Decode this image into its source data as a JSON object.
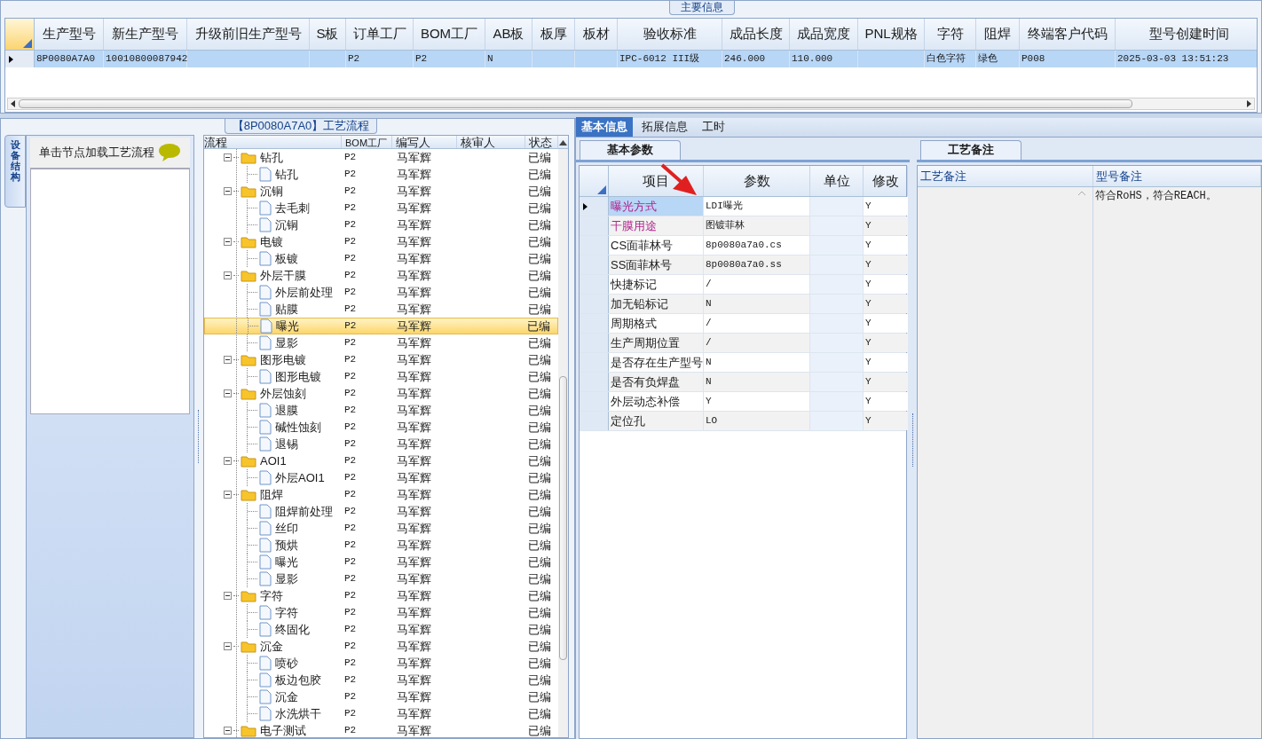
{
  "main_info": {
    "title": "主要信息",
    "columns": [
      "生产型号",
      "新生产型号",
      "升级前旧生产型号",
      "S板",
      "订单工厂",
      "BOM工厂",
      "AB板",
      "板厚",
      "板材",
      "验收标准",
      "成品长度",
      "成品宽度",
      "PNL规格",
      "字符",
      "阻焊",
      "终端客户代码",
      "型号创建时间"
    ],
    "rows": [
      {
        "selected": true,
        "cells": [
          "8P0080A7A0",
          "10010800087942",
          null,
          null,
          "P2",
          "P2",
          "N",
          null,
          null,
          "IPC-6012 III级",
          "246.000",
          "110.000",
          null,
          "白色字符",
          "绿色",
          "P008",
          "2025-03-03 13:51:23"
        ]
      }
    ]
  },
  "process_panel": {
    "title": "【8P0080A7A0】工艺流程",
    "side_tab": "设备结构",
    "hint": "单击节点加载工艺流程",
    "columns": [
      "流程",
      "BOM工厂",
      "编写人",
      "核审人",
      "状态"
    ],
    "nodes": [
      {
        "name": "钻孔",
        "bom": "P2",
        "writer": "马军辉",
        "status": "已编",
        "expanded": true,
        "selected": false,
        "children": [
          {
            "name": "钻孔",
            "bom": "P2",
            "writer": "马军辉",
            "status": "已编",
            "selected": false
          }
        ]
      },
      {
        "name": "沉铜",
        "bom": "P2",
        "writer": "马军辉",
        "status": "已编",
        "expanded": true,
        "selected": false,
        "children": [
          {
            "name": "去毛刺",
            "bom": "P2",
            "writer": "马军辉",
            "status": "已编",
            "selected": false
          },
          {
            "name": "沉铜",
            "bom": "P2",
            "writer": "马军辉",
            "status": "已编",
            "selected": false
          }
        ]
      },
      {
        "name": "电镀",
        "bom": "P2",
        "writer": "马军辉",
        "status": "已编",
        "expanded": true,
        "selected": false,
        "children": [
          {
            "name": "板镀",
            "bom": "P2",
            "writer": "马军辉",
            "status": "已编",
            "selected": false
          }
        ]
      },
      {
        "name": "外层干膜",
        "bom": "P2",
        "writer": "马军辉",
        "status": "已编",
        "expanded": true,
        "selected": false,
        "children": [
          {
            "name": "外层前处理",
            "bom": "P2",
            "writer": "马军辉",
            "status": "已编",
            "selected": false
          },
          {
            "name": "贴膜",
            "bom": "P2",
            "writer": "马军辉",
            "status": "已编",
            "selected": false
          },
          {
            "name": "曝光",
            "bom": "P2",
            "writer": "马军辉",
            "status": "已编",
            "selected": true
          },
          {
            "name": "显影",
            "bom": "P2",
            "writer": "马军辉",
            "status": "已编",
            "selected": false
          }
        ]
      },
      {
        "name": "图形电镀",
        "bom": "P2",
        "writer": "马军辉",
        "status": "已编",
        "expanded": true,
        "selected": false,
        "children": [
          {
            "name": "图形电镀",
            "bom": "P2",
            "writer": "马军辉",
            "status": "已编",
            "selected": false
          }
        ]
      },
      {
        "name": "外层蚀刻",
        "bom": "P2",
        "writer": "马军辉",
        "status": "已编",
        "expanded": true,
        "selected": false,
        "children": [
          {
            "name": "退膜",
            "bom": "P2",
            "writer": "马军辉",
            "status": "已编",
            "selected": false
          },
          {
            "name": "碱性蚀刻",
            "bom": "P2",
            "writer": "马军辉",
            "status": "已编",
            "selected": false
          },
          {
            "name": "退锡",
            "bom": "P2",
            "writer": "马军辉",
            "status": "已编",
            "selected": false
          }
        ]
      },
      {
        "name": "AOI1",
        "bom": "P2",
        "writer": "马军辉",
        "status": "已编",
        "expanded": true,
        "selected": false,
        "children": [
          {
            "name": "外层AOI1",
            "bom": "P2",
            "writer": "马军辉",
            "status": "已编",
            "selected": false
          }
        ]
      },
      {
        "name": "阻焊",
        "bom": "P2",
        "writer": "马军辉",
        "status": "已编",
        "expanded": true,
        "selected": false,
        "children": [
          {
            "name": "阻焊前处理",
            "bom": "P2",
            "writer": "马军辉",
            "status": "已编",
            "selected": false
          },
          {
            "name": "丝印",
            "bom": "P2",
            "writer": "马军辉",
            "status": "已编",
            "selected": false
          },
          {
            "name": "预烘",
            "bom": "P2",
            "writer": "马军辉",
            "status": "已编",
            "selected": false
          },
          {
            "name": "曝光",
            "bom": "P2",
            "writer": "马军辉",
            "status": "已编",
            "selected": false
          },
          {
            "name": "显影",
            "bom": "P2",
            "writer": "马军辉",
            "status": "已编",
            "selected": false
          }
        ]
      },
      {
        "name": "字符",
        "bom": "P2",
        "writer": "马军辉",
        "status": "已编",
        "expanded": true,
        "selected": false,
        "children": [
          {
            "name": "字符",
            "bom": "P2",
            "writer": "马军辉",
            "status": "已编",
            "selected": false
          },
          {
            "name": "终固化",
            "bom": "P2",
            "writer": "马军辉",
            "status": "已编",
            "selected": false
          }
        ]
      },
      {
        "name": "沉金",
        "bom": "P2",
        "writer": "马军辉",
        "status": "已编",
        "expanded": true,
        "selected": false,
        "children": [
          {
            "name": "喷砂",
            "bom": "P2",
            "writer": "马军辉",
            "status": "已编",
            "selected": false
          },
          {
            "name": "板边包胶",
            "bom": "P2",
            "writer": "马军辉",
            "status": "已编",
            "selected": false
          },
          {
            "name": "沉金",
            "bom": "P2",
            "writer": "马军辉",
            "status": "已编",
            "selected": false
          },
          {
            "name": "水洗烘干",
            "bom": "P2",
            "writer": "马军辉",
            "status": "已编",
            "selected": false
          }
        ]
      },
      {
        "name": "电子测试",
        "bom": "P2",
        "writer": "马军辉",
        "status": "已编",
        "expanded": true,
        "selected": false
      }
    ]
  },
  "detail": {
    "tabs": [
      {
        "label": "基本信息",
        "selected": true
      },
      {
        "label": "拓展信息",
        "selected": false
      },
      {
        "label": "工时",
        "selected": false
      }
    ],
    "params": {
      "tab": "基本参数",
      "columns": [
        "项目",
        "参数",
        "单位",
        "修改"
      ],
      "rows": [
        {
          "item": "曝光方式",
          "value": "LDI曝光",
          "modified": "Y",
          "emphasized": true,
          "selected": true
        },
        {
          "item": "干膜用途",
          "value": "图镀菲林",
          "modified": "Y",
          "emphasized": true,
          "selected": false
        },
        {
          "item": "CS面菲林号",
          "value": "8p0080a7a0.cs",
          "modified": "Y",
          "emphasized": false,
          "selected": false
        },
        {
          "item": "SS面菲林号",
          "value": "8p0080a7a0.ss",
          "modified": "Y",
          "emphasized": false,
          "selected": false
        },
        {
          "item": "快捷标记",
          "value": "/",
          "modified": "Y",
          "emphasized": false,
          "selected": false
        },
        {
          "item": "加无铅标记",
          "value": "N",
          "modified": "Y",
          "emphasized": false,
          "selected": false
        },
        {
          "item": "周期格式",
          "value": "/",
          "modified": "Y",
          "emphasized": false,
          "selected": false
        },
        {
          "item": "生产周期位置",
          "value": "/",
          "modified": "Y",
          "emphasized": false,
          "selected": false
        },
        {
          "item": "是否存在生产型号",
          "value": "N",
          "modified": "Y",
          "emphasized": false,
          "selected": false
        },
        {
          "item": "是否有负焊盘",
          "value": "N",
          "modified": "Y",
          "emphasized": false,
          "selected": false
        },
        {
          "item": "外层动态补偿",
          "value": "Y",
          "modified": "Y",
          "emphasized": false,
          "selected": false
        },
        {
          "item": "定位孔",
          "value": "LO",
          "modified": "Y",
          "emphasized": false,
          "selected": false
        }
      ]
    },
    "remarks": {
      "tab": "工艺备注",
      "columns": [
        "工艺备注",
        "型号备注"
      ],
      "model_remark": "符合RoHS，符合REACH。"
    }
  }
}
